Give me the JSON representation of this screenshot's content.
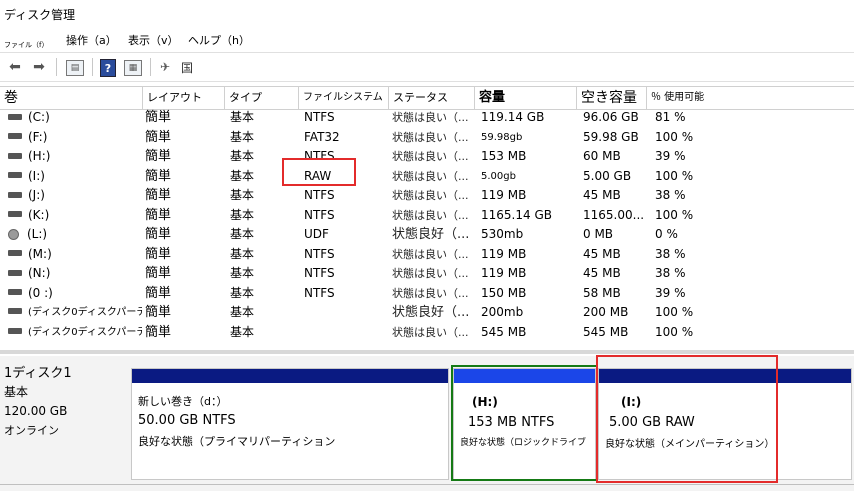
{
  "window": {
    "title": "ディスク管理"
  },
  "menu": {
    "file": "ファイル（f）",
    "action": "操作（a）",
    "view": "表示（v）",
    "help": "ヘルプ（h）"
  },
  "toolbar": {
    "icons": [
      "back-arrow-icon",
      "forward-arrow-icon",
      "properties-icon",
      "help-icon",
      "console-tree-icon",
      "connect-icon"
    ],
    "extra_label": "国"
  },
  "table": {
    "headers": [
      "巻",
      "レイアウト",
      "タイプ",
      "ファイルシステム",
      "ステータス",
      "容量",
      "空き容量",
      "％ 使用可能"
    ],
    "rows": [
      {
        "volume": "(C:)",
        "layout": "簡単",
        "type": "基本",
        "fs": "NTFS",
        "status": "状態は良い（...",
        "capacity": "119.14 GB",
        "free": "96.06 GB",
        "pct": "81 %"
      },
      {
        "volume": "(F:)",
        "layout": "簡単",
        "type": "基本",
        "fs": "FAT32",
        "status": "状態は良い（...",
        "capacity": "59.98gb",
        "free": "59.98 GB",
        "pct": "100 %"
      },
      {
        "volume": "(H:)",
        "layout": "簡単",
        "type": "基本",
        "fs": "NTFS",
        "status": "状態は良い（...",
        "capacity": "153 MB",
        "free": "60 MB",
        "pct": "39 %"
      },
      {
        "volume": "(I:)",
        "layout": "簡単",
        "type": "基本",
        "fs": "RAW",
        "status": "状態は良い（...",
        "capacity": "5.00gb",
        "free": "5.00 GB",
        "pct": "100 %"
      },
      {
        "volume": "(J:)",
        "layout": "簡単",
        "type": "基本",
        "fs": "NTFS",
        "status": "状態は良い（...",
        "capacity": "119 MB",
        "free": "45 MB",
        "pct": "38 %"
      },
      {
        "volume": "(K:)",
        "layout": "簡単",
        "type": "基本",
        "fs": "NTFS",
        "status": "状態は良い（...",
        "capacity": "1165.14 GB",
        "free": "1165.00...",
        "pct": "100 %"
      },
      {
        "volume": "(L:)",
        "layout": "簡単",
        "type": "基本",
        "fs": "UDF",
        "status": "状態良好（...",
        "capacity": "530mb",
        "free": "0 MB",
        "pct": "0 %"
      },
      {
        "volume": "(M:)",
        "layout": "簡単",
        "type": "基本",
        "fs": "NTFS",
        "status": "状態は良い（...",
        "capacity": "119 MB",
        "free": "45 MB",
        "pct": "38 %"
      },
      {
        "volume": "(N:)",
        "layout": "簡単",
        "type": "基本",
        "fs": "NTFS",
        "status": "状態は良い（...",
        "capacity": "119 MB",
        "free": "45 MB",
        "pct": "38 %"
      },
      {
        "volume": "(0 :)",
        "layout": "簡単",
        "type": "基本",
        "fs": "NTFS",
        "status": "状態は良い（...",
        "capacity": "150 MB",
        "free": "58 MB",
        "pct": "39 %"
      },
      {
        "volume": "(ディスク0ディスクパーティ...",
        "layout": "簡単",
        "type": "基本",
        "fs": "",
        "status": "状態良好（...",
        "capacity": "200mb",
        "free": "200 MB",
        "pct": "100 %"
      },
      {
        "volume": "(ディスク0ディスクパーティ...",
        "layout": "簡単",
        "type": "基本",
        "fs": "",
        "status": "状態は良い（...",
        "capacity": "545 MB",
        "free": "545 MB",
        "pct": "100 %"
      }
    ]
  },
  "disk": {
    "name": "1ディスク1",
    "type": "基本",
    "size": "120.00 GB",
    "state": "オンライン",
    "partitions": [
      {
        "name": "新しい巻き（d：）",
        "size": "50.00 GB NTFS",
        "status": "良好な状態（プライマリパーティション"
      },
      {
        "name": "(H:)",
        "size": "153 MB NTFS",
        "status": "良好な状態（ロジックドライブ"
      },
      {
        "name": "(I:)",
        "size": "5.00 GB RAW",
        "status": "良好な状態（メインパーティション）"
      }
    ]
  },
  "colors": {
    "primary_bar": "#0a1a82",
    "logical_bar": "#1b46e8",
    "highlight_red": "#e32b2b",
    "highlight_green": "#157a15"
  }
}
